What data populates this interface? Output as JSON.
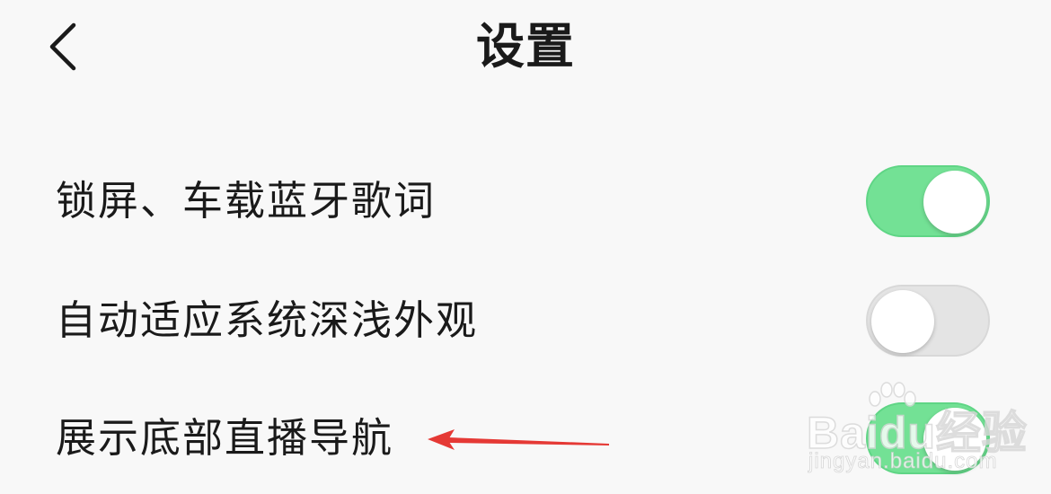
{
  "header": {
    "title": "设置",
    "back_icon": "chevron-left-icon"
  },
  "settings": [
    {
      "label": "锁屏、车载蓝牙歌词",
      "enabled": true
    },
    {
      "label": "自动适应系统深浅外观",
      "enabled": false
    },
    {
      "label": "展示底部直播导航",
      "enabled": true
    }
  ],
  "colors": {
    "background": "#f8f8f8",
    "toggle_on": "#73e195",
    "toggle_off": "#e4e4e4",
    "annotation_arrow": "#e53935"
  },
  "watermark": {
    "brand": "Baidu经验",
    "url": "jingyan.baidu.com"
  }
}
